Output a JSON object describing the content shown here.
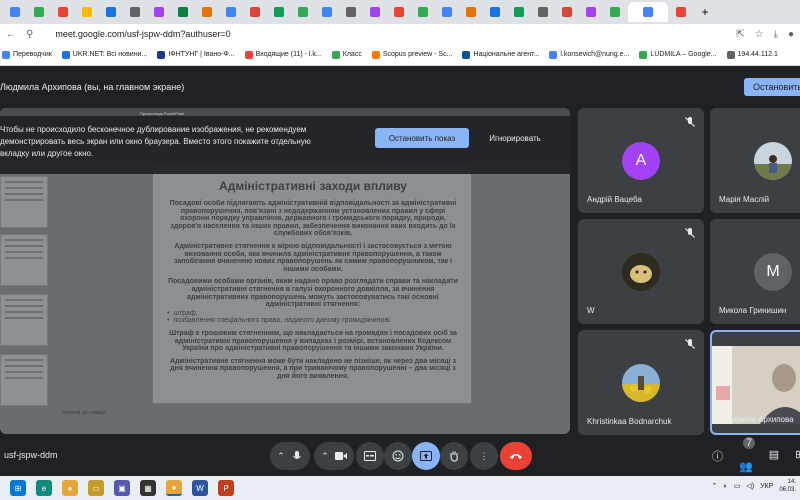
{
  "browser": {
    "tabs_count": 30,
    "url": "meet.google.com/usf-jspw-ddm?authuser=0",
    "bookmarks": [
      "Переводчик",
      "UKR.NET: Всі новини...",
      "ІФНТУНГ | Івано-Ф...",
      "Входящие (11) - l.k...",
      "Класс",
      "Scopus preview - Sc...",
      "Національне агент...",
      "l.konsevich@nung.e...",
      "LUDMILA – Google...",
      "194.44.112.1"
    ]
  },
  "presenter": {
    "label": "Людмила Архипова (вы, на главном экране)",
    "stop_button": "Остановить"
  },
  "share_warning": {
    "text": "Чтобы не происходило бесконечное дублирование изображения, не рекомендуем демонстрировать весь экран или окно браузера. Вместо этого покажите отдельную вкладку или другое окно.",
    "stop_label": "Остановить показ",
    "ignore_label": "Игнорировать"
  },
  "slide": {
    "title": "Адміністративні заходи впливу",
    "paragraph1": "Посадові особи підлягають адміністративній відповідальності за адміністративні правопорушення, пов'язані з недодержанням установлених правил у сфері охорони порядку управління, державного і громадського порядку, природи, здоров'я населення та інших правил, забезпечення виконання яких входить до їх службових обов'язків.",
    "paragraph2": "Адміністративне стягнення є мірою відповідальності і застосовується з метою виховання особи, яка вчинила адміністративне правопорушення, а також запобігання вчиненню нових правопорушень як самим правопорушником, так і іншими особами.",
    "paragraph3": "Посадовими особами органів, яким надано право розглядати справи та накладати адміністративні стягнення в галузі охоронного довкілля, за вчинення адміністративних правопорушень можуть застосовуватись такі основні адміністративні стягнення:",
    "bullets": [
      "штраф;",
      "позбавлення спеціального права, наданого даному громадянинові."
    ],
    "paragraph4": "Штраф є грошовим стягненням, що накладається на громадян і посадових осіб за адміністративні правопорушення у випадках і розмірі, встановлених Кодексом України про адміністративні правопорушення та іншими законами України.",
    "paragraph5": "Адміністративне стягнення може бути накладено не пізніше, як через два місяці з дня вчинення правопорушення, а при триваючому правопорушенні – два місяці з дня його виявлення.",
    "notes": "Нотатки до слайда"
  },
  "participants": [
    {
      "name": "Андрій Вацеба",
      "initial": "А",
      "color": "#a142f4"
    },
    {
      "name": "Марія Маслій",
      "initial": "",
      "color": "#7a8a6a"
    },
    {
      "name": "W",
      "initial": "",
      "color": "#6a5a3a"
    },
    {
      "name": "Микола Гринишин",
      "initial": "M",
      "color": "#5f6368"
    },
    {
      "name": "Khristinkaa Bodnarchuk",
      "initial": "",
      "color": "#9aa86a"
    },
    {
      "name": "Людмила Архипова",
      "initial": "",
      "color": "#b9b4a8"
    }
  ],
  "bottom": {
    "meeting_code": "usf-jspw-ddm",
    "people_count": "7"
  },
  "taskbar": {
    "lang": "УКР",
    "time": "14:",
    "date": "06.03."
  }
}
